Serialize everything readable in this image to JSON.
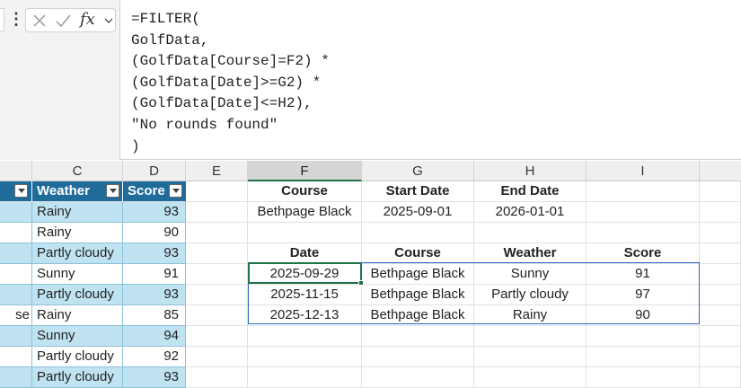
{
  "formula": {
    "lines": [
      "=FILTER(",
      "GolfData,",
      "(GolfData[Course]=F2) *",
      "(GolfData[Date]>=G2) *",
      "(GolfData[Date]<=H2),",
      "\"No rounds found\"",
      ")"
    ]
  },
  "icons": {
    "menu": "more-vertical-icon",
    "cancel": "close-icon",
    "confirm": "checkmark-icon",
    "function": "fx-icon",
    "expand": "chevron-down-icon"
  },
  "columns": [
    "C",
    "D",
    "E",
    "F",
    "G",
    "H",
    "I"
  ],
  "source_table": {
    "headers": [
      "Weather",
      "Score"
    ],
    "col_b_fragment": "se",
    "rows": [
      {
        "weather": "Rainy",
        "score": "93"
      },
      {
        "weather": "Rainy",
        "score": "90"
      },
      {
        "weather": "Partly cloudy",
        "score": "93"
      },
      {
        "weather": "Sunny",
        "score": "91"
      },
      {
        "weather": "Partly cloudy",
        "score": "93"
      },
      {
        "weather": "Rainy",
        "score": "85"
      },
      {
        "weather": "Sunny",
        "score": "94"
      },
      {
        "weather": "Partly cloudy",
        "score": "92"
      },
      {
        "weather": "Partly cloudy",
        "score": "93"
      }
    ]
  },
  "criteria": {
    "headers": [
      "Course",
      "Start Date",
      "End Date"
    ],
    "values": [
      "Bethpage Black",
      "2025-09-01",
      "2026-01-01"
    ]
  },
  "results": {
    "headers": [
      "Date",
      "Course",
      "Weather",
      "Score"
    ],
    "rows": [
      [
        "2025-09-29",
        "Bethpage Black",
        "Sunny",
        "91"
      ],
      [
        "2025-11-15",
        "Bethpage Black",
        "Partly cloudy",
        "97"
      ],
      [
        "2025-12-13",
        "Bethpage Black",
        "Rainy",
        "90"
      ]
    ]
  },
  "colors": {
    "table_header": "#1f6c9b",
    "band": "#c0e3f2",
    "selection": "#217346",
    "spill_border": "#2f66c4"
  }
}
